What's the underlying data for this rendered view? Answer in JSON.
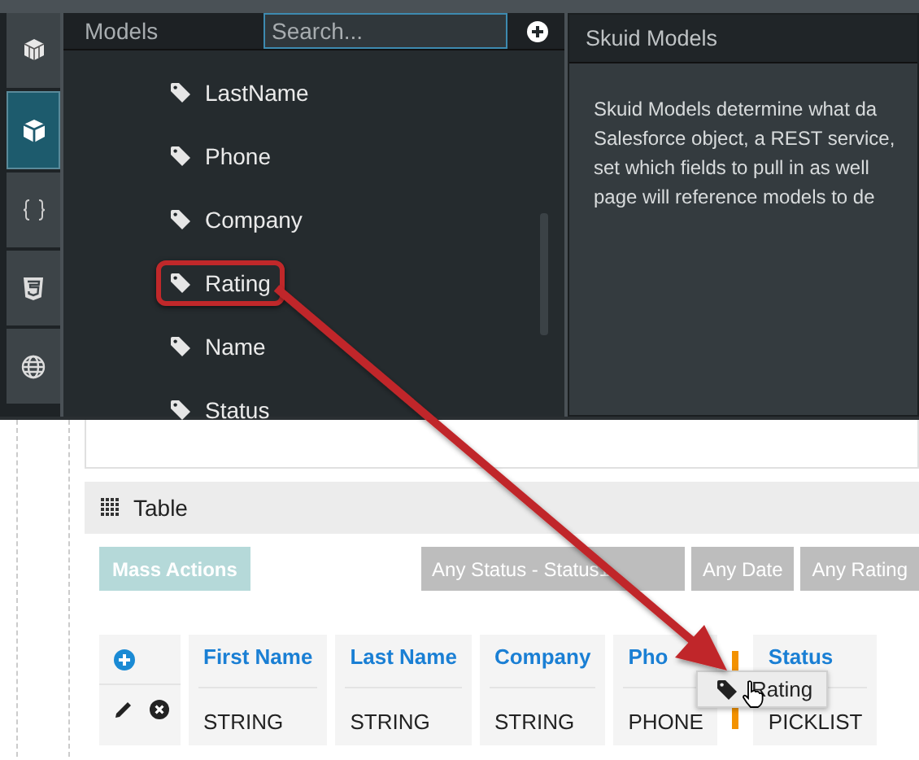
{
  "rail": [
    {
      "selected": false
    },
    {
      "selected": true
    },
    {
      "selected": false
    },
    {
      "selected": false
    },
    {
      "selected": false
    }
  ],
  "models_panel": {
    "title": "Models",
    "search": {
      "placeholder": "Search..."
    },
    "fields": [
      {
        "label": "LastName",
        "highlighted": false
      },
      {
        "label": "Phone",
        "highlighted": false
      },
      {
        "label": "Company",
        "highlighted": false
      },
      {
        "label": "Rating",
        "highlighted": true
      },
      {
        "label": "Name",
        "highlighted": false
      },
      {
        "label": "Status",
        "highlighted": false
      }
    ]
  },
  "help_panel": {
    "title": "Skuid Models",
    "lines": [
      "Skuid Models determine what da",
      "Salesforce object, a REST service,",
      "set which fields to pull in as well",
      "page will reference models to de"
    ]
  },
  "table_component": {
    "title": "Table",
    "mass_actions": "Mass Actions",
    "filters": [
      "Any Status - Status1",
      "Any Date",
      "Any Rating"
    ],
    "columns": [
      {
        "header": "First Name",
        "value": "STRING",
        "drop_before": false
      },
      {
        "header": "Last Name",
        "value": "STRING",
        "drop_before": false
      },
      {
        "header": "Company",
        "value": "STRING",
        "drop_before": false
      },
      {
        "header": "Pho",
        "value": "PHONE",
        "drop_before": false
      },
      {
        "header": "Status",
        "value": "PICKLIST",
        "drop_before": true
      }
    ]
  },
  "drag_item": {
    "label": "Rating"
  }
}
